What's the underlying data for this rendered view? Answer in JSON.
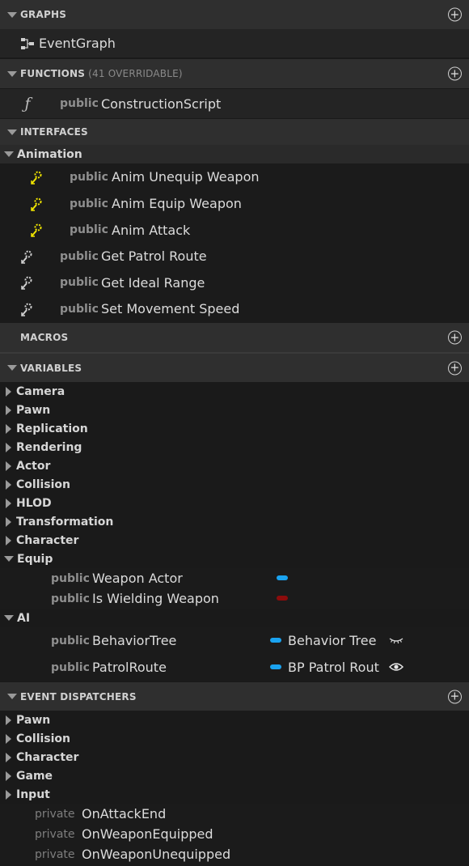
{
  "graphs": {
    "header": "GRAPHS",
    "items": [
      {
        "label": "EventGraph"
      }
    ]
  },
  "functions": {
    "header": "FUNCTIONS",
    "sub": "(41 OVERRIDABLE)",
    "items": [
      {
        "access": "public",
        "label": "ConstructionScript"
      }
    ]
  },
  "interfaces": {
    "header": "INTERFACES",
    "group": "Animation",
    "items": [
      {
        "access": "public",
        "label": "Anim Unequip Weapon"
      },
      {
        "access": "public",
        "label": "Anim Equip Weapon"
      },
      {
        "access": "public",
        "label": "Anim Attack"
      },
      {
        "access": "public",
        "label": "Get Patrol Route"
      },
      {
        "access": "public",
        "label": "Get Ideal Range"
      },
      {
        "access": "public",
        "label": "Set Movement Speed"
      }
    ]
  },
  "macros": {
    "header": "MACROS"
  },
  "variables": {
    "header": "VARIABLES",
    "categories": [
      "Camera",
      "Pawn",
      "Replication",
      "Rendering",
      "Actor",
      "Collision",
      "HLOD",
      "Transformation",
      "Character"
    ],
    "equip": {
      "label": "Equip",
      "items": [
        {
          "access": "public",
          "label": "Weapon Actor",
          "color": "#1aa3f0"
        },
        {
          "access": "public",
          "label": "Is Wielding Weapon",
          "color": "#8c0c0c"
        }
      ]
    },
    "ai": {
      "label": "AI",
      "items": [
        {
          "access": "public",
          "label": "BehaviorTree",
          "type": "Behavior Tree",
          "color": "#1aa3f0",
          "vis": "eye-closed-icon"
        },
        {
          "access": "public",
          "label": "PatrolRoute",
          "type": "BP Patrol Rout",
          "color": "#1aa3f0",
          "vis": "eye-open-icon"
        }
      ]
    }
  },
  "dispatchers": {
    "header": "EVENT DISPATCHERS",
    "categories": [
      "Pawn",
      "Collision",
      "Character",
      "Game",
      "Input"
    ],
    "items": [
      {
        "access": "private",
        "label": "OnAttackEnd"
      },
      {
        "access": "private",
        "label": "OnWeaponEquipped"
      },
      {
        "access": "private",
        "label": "OnWeaponUnequipped"
      }
    ]
  },
  "colors": {
    "section_bg": "#2f2f2f",
    "panel_bg": "#1a1a1a",
    "interface_icon": "#f2e600"
  }
}
